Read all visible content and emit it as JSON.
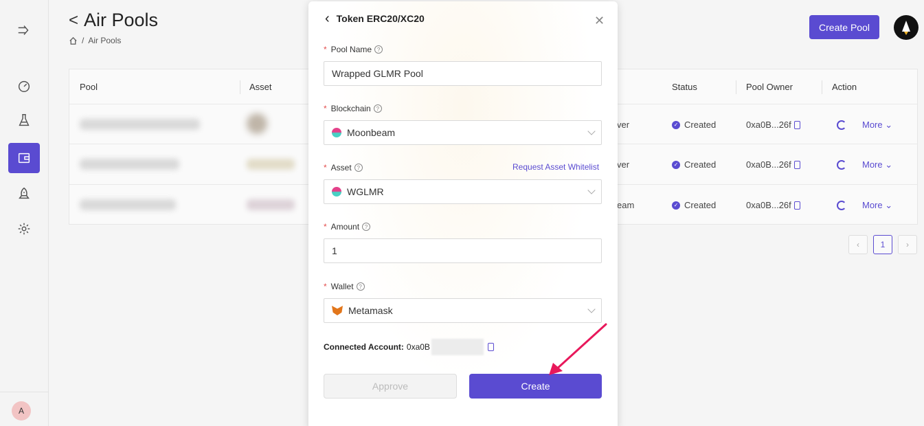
{
  "page": {
    "title": "Air Pools",
    "breadcrumb": "Air Pools",
    "breadcrumb_separator": "/",
    "create_pool_label": "Create Pool"
  },
  "sidebar": {
    "avatar_initial": "A",
    "items": [
      "expand-icon",
      "dashboard-icon",
      "flask-icon",
      "wallet-icon",
      "rocket-icon",
      "gear-icon"
    ]
  },
  "table": {
    "columns": [
      "Pool",
      "Asset",
      "Status",
      "Pool Owner",
      "Action"
    ],
    "rows": [
      {
        "partial": "ver",
        "status": "Created",
        "owner": "0xa0B...26f",
        "action": "More"
      },
      {
        "partial": "ver",
        "status": "Created",
        "owner": "0xa0B...26f",
        "action": "More"
      },
      {
        "partial": "eam",
        "status": "Created",
        "owner": "0xa0B...26f",
        "action": "More"
      }
    ],
    "current_page": "1"
  },
  "modal": {
    "title": "Token ERC20/XC20",
    "pool_name_label": "Pool Name",
    "pool_name_value": "Wrapped GLMR Pool",
    "blockchain_label": "Blockchain",
    "blockchain_value": "Moonbeam",
    "asset_label": "Asset",
    "asset_value": "WGLMR",
    "request_whitelist": "Request Asset Whitelist",
    "amount_label": "Amount",
    "amount_value": "1",
    "wallet_label": "Wallet",
    "wallet_value": "Metamask",
    "connected_label": "Connected Account:",
    "connected_prefix": "0xa0B",
    "approve_label": "Approve",
    "create_label": "Create"
  },
  "colors": {
    "accent": "#5a4bd1",
    "annotation_arrow": "#e8185b"
  }
}
